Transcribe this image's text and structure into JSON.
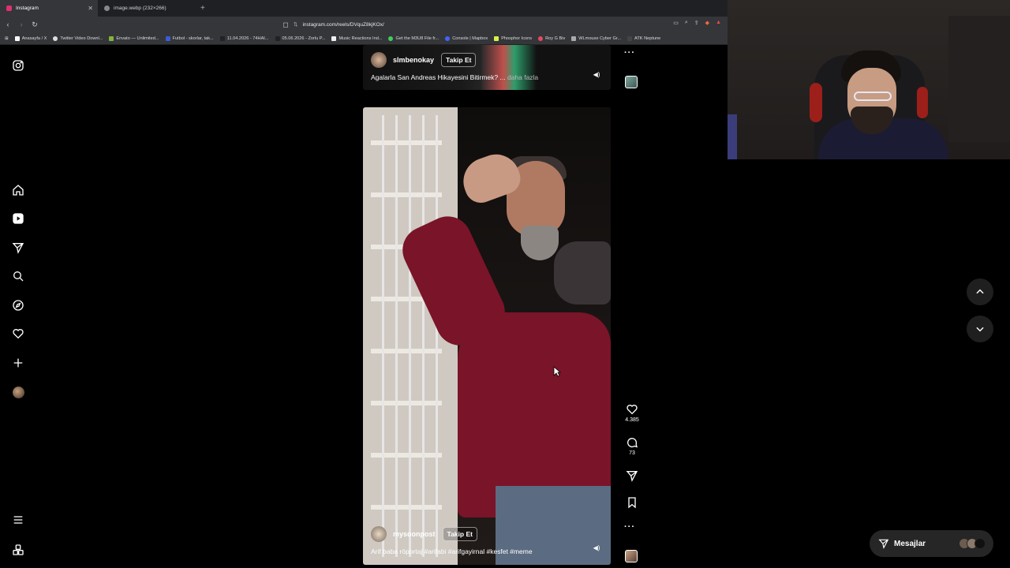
{
  "browser": {
    "tabs": [
      {
        "title": "Instagram",
        "active": true,
        "color": "#e1306c"
      },
      {
        "title": "image.webp (232×266)",
        "active": false,
        "color": "#888888"
      }
    ],
    "url": "instagram.com/reels/DVquZ8kjKOx/",
    "bookmarks": [
      "Anasayfa / X",
      "Twitter Video Downl...",
      "Envato — Unlimited...",
      "Futbol - skorlar, tak...",
      "11.04.2026 - 74HAI...",
      "05.06.2026 - Zorlu P...",
      "Music Reactions Ind...",
      "Get the M3U8 File fr...",
      "Console | Mapbox",
      "Phosphor Icons",
      "Roy G Biv",
      "WLmouse Cyber Gr...",
      "ATK Neptune"
    ]
  },
  "sidebar": {
    "icons": [
      "instagram-icon",
      "home-icon",
      "reels-icon",
      "send-icon",
      "search-icon",
      "explore-icon",
      "heart-icon",
      "create-icon",
      "profile-avatar",
      "menu-icon",
      "more-icon"
    ]
  },
  "reels": {
    "top": {
      "username": "slmbenokay",
      "follow_label": "Takip Et",
      "caption": "Agalarla San Andreas Hikayesini Bitirmek? ...",
      "more_label": "daha fazla"
    },
    "main": {
      "username": "mysoonpost",
      "follow_label": "Takip Et",
      "caption": "Arif baba röportaj #arifabi #arifgayirnal #kesfet #meme",
      "likes": "4.385",
      "comments": "73"
    }
  },
  "messages": {
    "label": "Mesajlar"
  },
  "colors": {
    "background": "#000000",
    "chrome": "#35363a",
    "messages_bg": "#262626"
  }
}
